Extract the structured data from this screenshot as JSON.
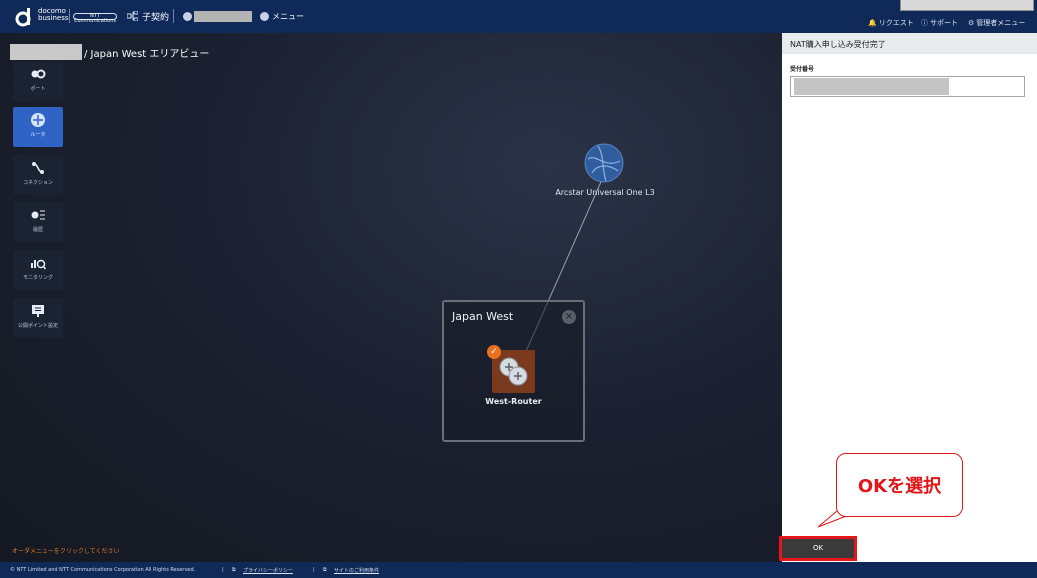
{
  "header": {
    "logo_text_line1": "docomo",
    "logo_text_line2": "business",
    "ntt_logo_text": "NTT Communications",
    "contract_label": "子契約",
    "menu_label": "メニュー",
    "right_items": [
      {
        "label": "リクエスト",
        "icon": "bell-icon"
      },
      {
        "label": "サポート",
        "icon": "help-icon"
      },
      {
        "label": "管理者メニュー",
        "icon": "gear-icon"
      }
    ]
  },
  "breadcrumb": {
    "suffix": "/ Japan West エリアビュー"
  },
  "sidebar": {
    "items": [
      {
        "label": "ポート",
        "icon": "port-icon",
        "active": false
      },
      {
        "label": "ルータ",
        "icon": "router-icon",
        "active": true
      },
      {
        "label": "コネクション",
        "icon": "connection-icon",
        "active": false
      },
      {
        "label": "履歴",
        "icon": "history-icon",
        "active": false
      },
      {
        "label": "モニタリング",
        "icon": "monitoring-icon",
        "active": false
      },
      {
        "label": "公開ポイント設定",
        "icon": "public-point-icon",
        "active": false
      }
    ]
  },
  "topology": {
    "cloud_label": "Arcstar Universal One L3",
    "area_title": "Japan West",
    "router_label": "West-Router"
  },
  "order_hint": "オーダメニューをクリックしてください",
  "footer": {
    "copyright": "© NTT Limited and NTT Communications Corporation All Rights Reserved.",
    "privacy": "プライバシーポリシー",
    "terms": "サイトのご利用条件"
  },
  "panel": {
    "title": "NAT購入申し込み受付完了",
    "field_label": "受付番号",
    "ok_label": "OK"
  },
  "callout": {
    "text": "OKを選択"
  },
  "colors": {
    "header_bg": "#0f2a59",
    "active_nav": "#2f63c6",
    "router_tile": "#7a3a1e",
    "check_badge": "#e8711f",
    "highlight_red": "#e3161a"
  }
}
